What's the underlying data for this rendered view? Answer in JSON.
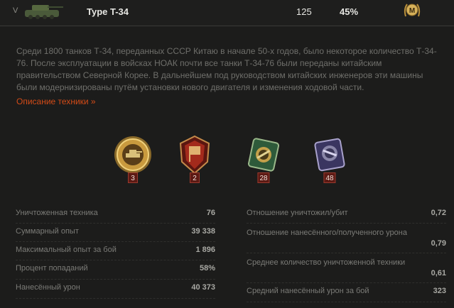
{
  "header": {
    "tier": "V",
    "tank_name": "Type T-34",
    "battles": "125",
    "win_rate": "45%",
    "mastery_icon": "mastery-m-icon"
  },
  "description": {
    "text": "Среди 1800 танков Т-34, переданных СССР Китаю в начале 50-х годов, было некоторое количество Т-34-76. После эксплуатации в войсках НОАК почти все танки Т-34-76 были переданы китайским правительством Северной Корее. В дальнейшем под руководством китайских инженеров эти машины были модернизированы путём установки нового двигателя и изменения ходовой части.",
    "link_label": "Описание техники »"
  },
  "medals": [
    {
      "name": "gold-tank-medal-icon",
      "count": "3"
    },
    {
      "name": "red-banner-medal-icon",
      "count": "2"
    },
    {
      "name": "green-shield-medal-icon",
      "count": "28"
    },
    {
      "name": "purple-shield-medal-icon",
      "count": "48"
    }
  ],
  "stats_left": [
    {
      "label": "Уничтоженная техника",
      "value": "76"
    },
    {
      "label": "Суммарный опыт",
      "value": "39 338"
    },
    {
      "label": "Максимальный опыт за бой",
      "value": "1 896"
    },
    {
      "label": "Процент попаданий",
      "value": "58%"
    },
    {
      "label": "Нанесённый урон",
      "value": "40 373"
    }
  ],
  "stats_right": [
    {
      "label": "Отношение уничтожил/убит",
      "value": "0,72"
    },
    {
      "label": "Отношение нанесённого/полученного урона",
      "value": "0,79"
    },
    {
      "label": "Среднее количество уничтоженной техники",
      "value": "0,61"
    },
    {
      "label": "Средний нанесённый урон за бой",
      "value": "323"
    }
  ],
  "colors": {
    "accent_link": "#d34b17",
    "background": "#1c1c1b",
    "badge_bg": "#5c1a14"
  }
}
